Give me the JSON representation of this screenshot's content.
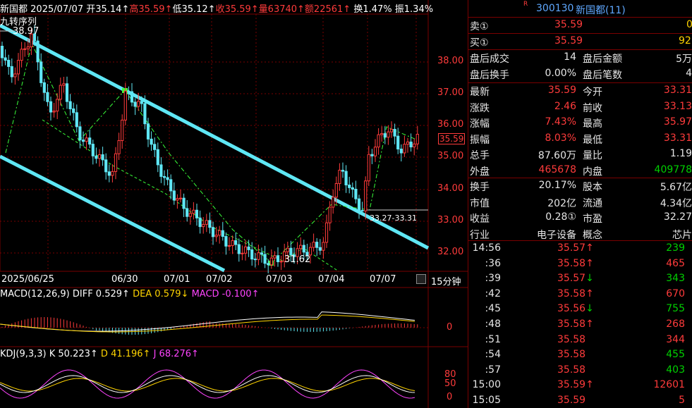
{
  "quote_header": {
    "name": "新国都",
    "date": "2025/07/07",
    "open": "开35.14↑",
    "high": "高35.59↑",
    "low": "低35.12↑",
    "close": "收35.59↑",
    "volume": "量63740↑",
    "amount": "额22561↑",
    "turnover": "换1.47%",
    "amplitude": "振1.34%"
  },
  "indicator_label": "九转序列",
  "price_high_label": "38.97",
  "price_low_label": "31.62",
  "channel_label": "33.27-33.31",
  "current_price_tag": "35.59",
  "price_axis": [
    "38.00",
    "37.00",
    "36.00",
    "35.00",
    "34.00",
    "33.00",
    "32.00"
  ],
  "date_axis": [
    "2025/06/25",
    "06/30",
    "07/01",
    "07/02",
    "07/03",
    "07/04",
    "07/07"
  ],
  "period_button": "15分钟",
  "macd": {
    "name": "MACD(12,26,9)",
    "diff": "DIFF 0.529↑",
    "dea": "DEA 0.579↓",
    "macd": "MACD -0.100↑",
    "axis_zero": "0"
  },
  "kdj": {
    "name": "KDJ(9,3,3)",
    "k": "K 50.223↑",
    "d": "D 41.196↑",
    "j": "J 68.276↑",
    "axis": [
      "80",
      "50",
      "0"
    ]
  },
  "colors": {
    "up": "#ff3b3b",
    "down": "#00d000",
    "channel": "#5fe7f5",
    "grid": "#7a0000",
    "diff": "#ffffff",
    "dea": "#ffd400",
    "macd_label": "#ff44ff"
  },
  "panel": {
    "title_code": "300130",
    "title_name": "新国都(11)",
    "title_flag": "R",
    "sell": {
      "label": "卖①",
      "price": "35.59",
      "vol": "0"
    },
    "buy": {
      "label": "买①",
      "price": "35.59",
      "vol": "92"
    },
    "after_hours": [
      {
        "l1": "盘后成交",
        "v1": "14",
        "l2": "盘后金额",
        "v2": "5万"
      },
      {
        "l1": "盘后换手",
        "v1": "0.00%",
        "l2": "盘后笔数",
        "v2": "4"
      }
    ],
    "stats": [
      {
        "l1": "最新",
        "v1": "35.59",
        "l2": "今开",
        "v2": "33.31"
      },
      {
        "l1": "涨跌",
        "v1": "2.46",
        "l2": "前收",
        "v2": "33.13"
      },
      {
        "l1": "涨幅",
        "v1": "7.43%",
        "l2": "最高",
        "v2": "35.97"
      },
      {
        "l1": "振幅",
        "v1": "8.03%",
        "l2": "最低",
        "v2": "33.31"
      },
      {
        "l1": "总手",
        "v1": "87.60万",
        "l2": "量比",
        "v2": "1.19"
      },
      {
        "l1": "外盘",
        "v1": "465678",
        "l2": "内盘",
        "v2": "409778"
      }
    ],
    "fund": [
      {
        "l1": "换手",
        "v1": "20.17%",
        "l2": "股本",
        "v2": "5.67亿"
      },
      {
        "l1": "市值",
        "v1": "202亿",
        "l2": "流通",
        "v2": "4.34亿"
      },
      {
        "l1": "收益",
        "v1": "0.28①",
        "l2": "市盈",
        "v2": "32.27"
      },
      {
        "l1": "行业",
        "v1": "电子设备",
        "l2": "概念",
        "v2": "芯片"
      }
    ],
    "ticks": [
      {
        "t": "14:56",
        "p": "35.57↑",
        "v": "239"
      },
      {
        "t": ":36",
        "p": "35.58↑",
        "v": "465"
      },
      {
        "t": ":39",
        "p": "35.57↓",
        "v": "343"
      },
      {
        "t": ":42",
        "p": "35.58↑",
        "v": "670"
      },
      {
        "t": ":45",
        "p": "35.56↓",
        "v": "755"
      },
      {
        "t": ":48",
        "p": "35.58↑",
        "v": "268"
      },
      {
        "t": ":51",
        "p": "35.58",
        "v": "344"
      },
      {
        "t": ":54",
        "p": "35.58",
        "v": "455"
      },
      {
        "t": ":57",
        "p": "35.58",
        "v": "403"
      },
      {
        "t": "15:00",
        "p": "35.59↑",
        "v": "12601"
      },
      {
        "t": "15:05",
        "p": "35.59",
        "v": "5"
      }
    ]
  }
}
